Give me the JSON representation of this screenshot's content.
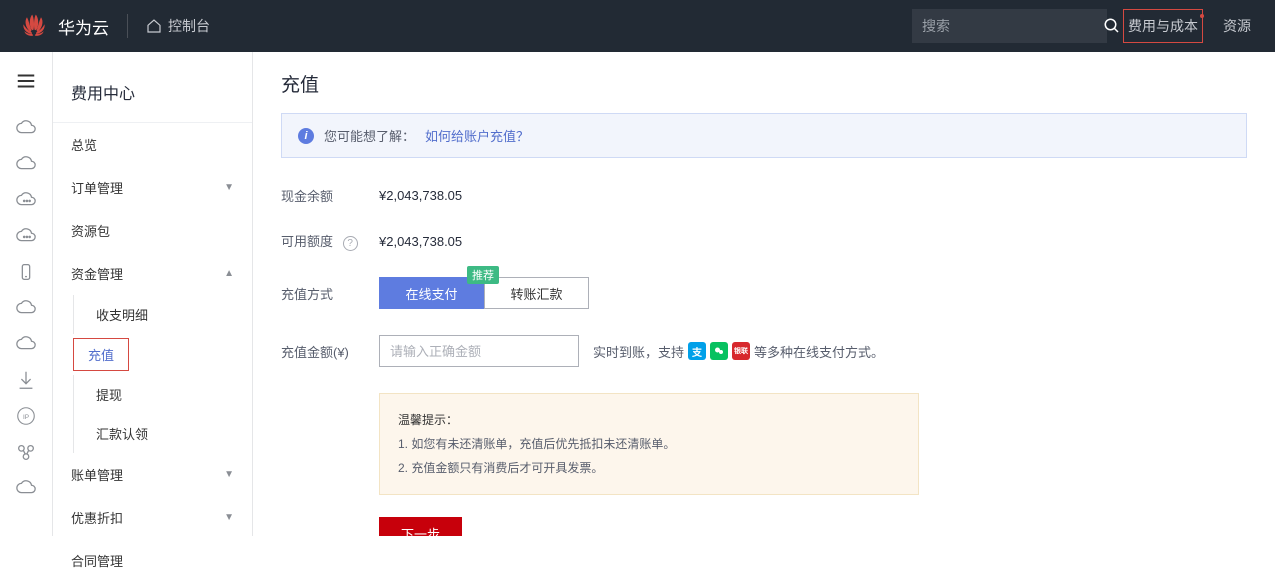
{
  "header": {
    "brand": "华为云",
    "console": "控制台",
    "search_placeholder": "搜索",
    "links": {
      "billing": "费用与成本",
      "resources": "资源"
    }
  },
  "sidebar": {
    "title": "费用中心",
    "items": {
      "overview": "总览",
      "orders": "订单管理",
      "resource_pkg": "资源包",
      "funds": "资金管理",
      "bills": "账单管理",
      "discounts": "优惠折扣",
      "contracts": "合同管理"
    },
    "funds_children": {
      "transactions": "收支明细",
      "recharge": "充值",
      "withdraw": "提现",
      "remit_claim": "汇款认领"
    }
  },
  "page": {
    "title": "充值",
    "info_prefix": "您可能想了解：",
    "info_link": "如何给账户充值？",
    "labels": {
      "cash_balance": "现金余额",
      "available_quota": "可用额度",
      "method": "充值方式",
      "amount": "充值金额(¥)"
    },
    "values": {
      "cash_balance": "¥2,043,738.05",
      "available_quota": "¥2,043,738.05"
    },
    "methods": {
      "online": "在线支付",
      "transfer": "转账汇款",
      "recommend": "推荐"
    },
    "amount_placeholder": "请输入正确金额",
    "amount_hint_prefix": "实时到账，支持",
    "amount_hint_suffix": "等多种在线支付方式。",
    "tips": {
      "title": "温馨提示：",
      "line1": "1. 如您有未还清账单，充值后优先抵扣未还清账单。",
      "line2": "2. 充值金额只有消费后才可开具发票。"
    },
    "next_btn": "下一步"
  }
}
